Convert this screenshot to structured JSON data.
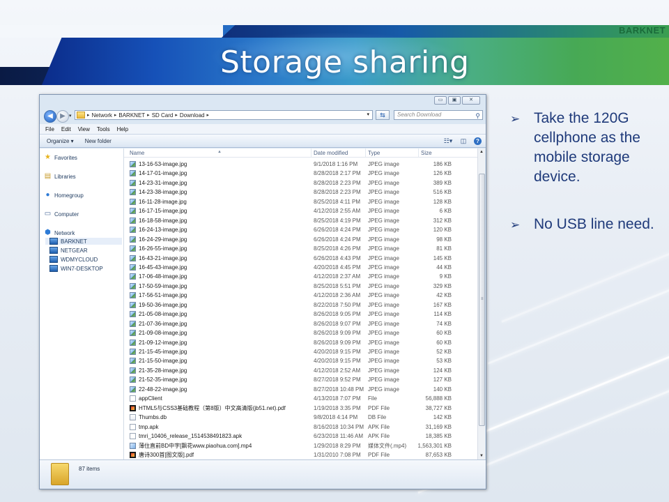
{
  "brand": "BARKNET",
  "slide_title": "Storage sharing",
  "explorer": {
    "window_controls": {
      "minimize": "▭",
      "maximize": "▣",
      "close": "✕"
    },
    "address": {
      "crumbs": [
        "Network",
        "BARKNET",
        "SD Card",
        "Download"
      ],
      "search_placeholder": "Search Download"
    },
    "menu": [
      "File",
      "Edit",
      "View",
      "Tools",
      "Help"
    ],
    "toolbar": {
      "organize": "Organize ▾",
      "new_folder": "New folder"
    },
    "nav": {
      "favorites": "Favorites",
      "libraries": "Libraries",
      "homegroup": "Homegroup",
      "computer": "Computer",
      "network": "Network",
      "network_children": [
        "BARKNET",
        "NETGEAR",
        "WDMYCLOUD",
        "WIN7-DESKTOP"
      ]
    },
    "columns": {
      "name": "Name",
      "date": "Date modified",
      "type": "Type",
      "size": "Size"
    },
    "files": [
      {
        "name": "13-16-53-image.jpg",
        "date": "9/1/2018 1:16 PM",
        "type": "JPEG image",
        "size": "186 KB",
        "icon": "image"
      },
      {
        "name": "14-17-01-image.jpg",
        "date": "8/28/2018 2:17 PM",
        "type": "JPEG image",
        "size": "126 KB",
        "icon": "image"
      },
      {
        "name": "14-23-31-image.jpg",
        "date": "8/28/2018 2:23 PM",
        "type": "JPEG image",
        "size": "389 KB",
        "icon": "image"
      },
      {
        "name": "14-23-38-image.jpg",
        "date": "8/28/2018 2:23 PM",
        "type": "JPEG image",
        "size": "516 KB",
        "icon": "image"
      },
      {
        "name": "16-11-28-image.jpg",
        "date": "8/25/2018 4:11 PM",
        "type": "JPEG image",
        "size": "128 KB",
        "icon": "image"
      },
      {
        "name": "16-17-15-image.jpg",
        "date": "4/12/2018 2:55 AM",
        "type": "JPEG image",
        "size": "6 KB",
        "icon": "image"
      },
      {
        "name": "16-18-58-image.jpg",
        "date": "8/25/2018 4:19 PM",
        "type": "JPEG image",
        "size": "312 KB",
        "icon": "image"
      },
      {
        "name": "16-24-13-image.jpg",
        "date": "6/26/2018 4:24 PM",
        "type": "JPEG image",
        "size": "120 KB",
        "icon": "image"
      },
      {
        "name": "16-24-29-image.jpg",
        "date": "6/26/2018 4:24 PM",
        "type": "JPEG image",
        "size": "98 KB",
        "icon": "image"
      },
      {
        "name": "16-26-55-image.jpg",
        "date": "8/25/2018 4:26 PM",
        "type": "JPEG image",
        "size": "81 KB",
        "icon": "image"
      },
      {
        "name": "16-43-21-image.jpg",
        "date": "6/26/2018 4:43 PM",
        "type": "JPEG image",
        "size": "145 KB",
        "icon": "image"
      },
      {
        "name": "16-45-43-image.jpg",
        "date": "4/20/2018 4:45 PM",
        "type": "JPEG image",
        "size": "44 KB",
        "icon": "image"
      },
      {
        "name": "17-06-48-image.jpg",
        "date": "4/12/2018 2:37 AM",
        "type": "JPEG image",
        "size": "9 KB",
        "icon": "image"
      },
      {
        "name": "17-50-59-image.jpg",
        "date": "8/25/2018 5:51 PM",
        "type": "JPEG image",
        "size": "329 KB",
        "icon": "image"
      },
      {
        "name": "17-56-51-image.jpg",
        "date": "4/12/2018 2:36 AM",
        "type": "JPEG image",
        "size": "42 KB",
        "icon": "image"
      },
      {
        "name": "19-50-36-image.jpg",
        "date": "8/22/2018 7:50 PM",
        "type": "JPEG image",
        "size": "167 KB",
        "icon": "image"
      },
      {
        "name": "21-05-08-image.jpg",
        "date": "8/26/2018 9:05 PM",
        "type": "JPEG image",
        "size": "114 KB",
        "icon": "image"
      },
      {
        "name": "21-07-36-image.jpg",
        "date": "8/26/2018 9:07 PM",
        "type": "JPEG image",
        "size": "74 KB",
        "icon": "image"
      },
      {
        "name": "21-09-08-image.jpg",
        "date": "8/26/2018 9:09 PM",
        "type": "JPEG image",
        "size": "60 KB",
        "icon": "image"
      },
      {
        "name": "21-09-12-image.jpg",
        "date": "8/26/2018 9:09 PM",
        "type": "JPEG image",
        "size": "60 KB",
        "icon": "image"
      },
      {
        "name": "21-15-45-image.jpg",
        "date": "4/20/2018 9:15 PM",
        "type": "JPEG image",
        "size": "52 KB",
        "icon": "image"
      },
      {
        "name": "21-15-50-image.jpg",
        "date": "4/20/2018 9:15 PM",
        "type": "JPEG image",
        "size": "53 KB",
        "icon": "image"
      },
      {
        "name": "21-35-28-image.jpg",
        "date": "4/12/2018 2:52 AM",
        "type": "JPEG image",
        "size": "124 KB",
        "icon": "image"
      },
      {
        "name": "21-52-35-image.jpg",
        "date": "8/27/2018 9:52 PM",
        "type": "JPEG image",
        "size": "127 KB",
        "icon": "image"
      },
      {
        "name": "22-48-22-image.jpg",
        "date": "8/27/2018 10:48 PM",
        "type": "JPEG image",
        "size": "140 KB",
        "icon": "image"
      },
      {
        "name": "appClient",
        "date": "4/13/2018 7:07 PM",
        "type": "File",
        "size": "56,888 KB",
        "icon": "file"
      },
      {
        "name": "HTML5与CSS3基础教程（第8版）中文高清版(jb51.net).pdf",
        "date": "1/19/2018 3:35 PM",
        "type": "PDF File",
        "size": "38,727 KB",
        "icon": "pdf"
      },
      {
        "name": "Thumbs.db",
        "date": "9/8/2018 4:14 PM",
        "type": "DB File",
        "size": "142 KB",
        "icon": "db"
      },
      {
        "name": "tmp.apk",
        "date": "8/16/2018 10:34 PM",
        "type": "APK File",
        "size": "31,169 KB",
        "icon": "apk"
      },
      {
        "name": "tmri_10406_release_1514538491823.apk",
        "date": "6/23/2018 11:46 AM",
        "type": "APK File",
        "size": "18,385 KB",
        "icon": "apk"
      },
      {
        "name": "薄住直前BD中字[飘花www.piaohua.com].mp4",
        "date": "1/29/2018 8:29 PM",
        "type": "媒体文件(.mp4)",
        "size": "1,563,301 KB",
        "icon": "mp4"
      },
      {
        "name": "唐诗300首[图文版].pdf",
        "date": "1/31/2010 7:08 PM",
        "type": "PDF File",
        "size": "87,653 KB",
        "icon": "pdf"
      }
    ],
    "item_count": "87 items"
  },
  "bullets": [
    "Take the 120G cellphone as the mobile storage device.",
    "No USB line need."
  ]
}
